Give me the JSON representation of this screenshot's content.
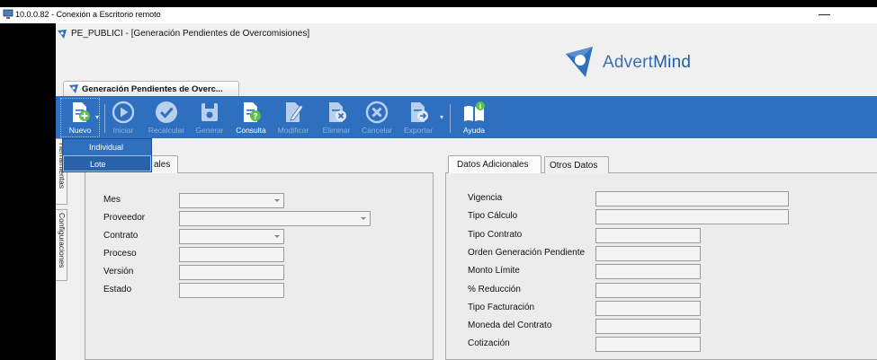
{
  "remote_window": {
    "title": "10.0.0.82 - Conexión a Escritorio remoto",
    "minimize": "—"
  },
  "app": {
    "title": "PE_PUBLICI - [Generación Pendientes de Overcomisiones]"
  },
  "logo": {
    "text_a": "Advert",
    "text_b": "Mind",
    "brand_color": "#1f5ea8"
  },
  "document_tab": {
    "label": "Generación Pendientes de Overc..."
  },
  "toolbar": {
    "color": "#2f6fbf",
    "buttons": [
      {
        "label": "Nuevo",
        "icon": "new-document-plus-icon",
        "enabled": true
      },
      {
        "label": "Iniciar",
        "icon": "play-circle-icon",
        "enabled": false
      },
      {
        "label": "Recalcular",
        "icon": "check-circle-icon",
        "enabled": false
      },
      {
        "label": "Generar",
        "icon": "save-disk-icon",
        "enabled": false
      },
      {
        "label": "Consulta",
        "icon": "document-question-icon",
        "enabled": true
      },
      {
        "label": "Modificar",
        "icon": "edit-document-icon",
        "enabled": false
      },
      {
        "label": "Eliminar",
        "icon": "delete-document-icon",
        "enabled": false
      },
      {
        "label": "Cancelar",
        "icon": "cancel-circle-icon",
        "enabled": false
      },
      {
        "label": "Exportar",
        "icon": "export-document-icon",
        "enabled": false
      },
      {
        "label": "Ayuda",
        "icon": "help-book-icon",
        "enabled": true
      }
    ]
  },
  "nuevo_menu": {
    "items": [
      {
        "label": "Individual"
      },
      {
        "label": "Lote"
      }
    ]
  },
  "side_tabs": {
    "herramientas": "Herramientas",
    "configuraciones": "Configuraciones"
  },
  "left_panel": {
    "tab_label": "Datos Generales",
    "tab_visible_text": "ales",
    "fields": [
      {
        "label": "Mes",
        "value": "",
        "type": "combo"
      },
      {
        "label": "Proveedor",
        "value": "",
        "type": "combo"
      },
      {
        "label": "Contrato",
        "value": "",
        "type": "combo"
      },
      {
        "label": "Proceso",
        "value": "",
        "type": "text"
      },
      {
        "label": "Versión",
        "value": "",
        "type": "text"
      },
      {
        "label": "Estado",
        "value": "",
        "type": "text"
      }
    ]
  },
  "right_panel": {
    "tabs": [
      {
        "label": "Datos Adicionales"
      },
      {
        "label": "Otros Datos"
      }
    ],
    "fields": [
      {
        "label": "Vigencia",
        "value": ""
      },
      {
        "label": "Tipo Cálculo",
        "value": ""
      },
      {
        "label": "Tipo Contrato",
        "value": ""
      },
      {
        "label": "Orden Generación Pendiente",
        "value": ""
      },
      {
        "label": "Monto Límite",
        "value": ""
      },
      {
        "label": "% Reducción",
        "value": ""
      },
      {
        "label": "Tipo Facturación",
        "value": ""
      },
      {
        "label": "Moneda del Contrato",
        "value": ""
      },
      {
        "label": "Cotización",
        "value": ""
      }
    ]
  }
}
